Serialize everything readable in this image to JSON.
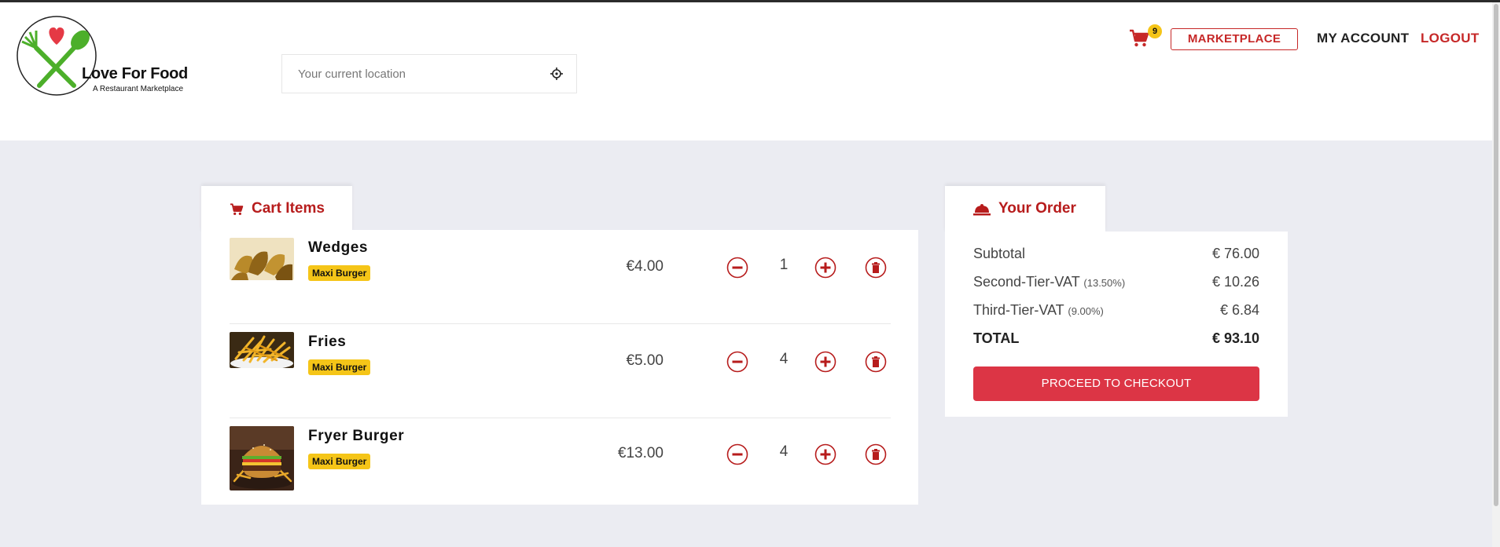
{
  "brand": {
    "name": "Love For Food",
    "tagline": "A Restaurant Marketplace"
  },
  "search": {
    "placeholder": "Your current location"
  },
  "nav": {
    "cart_count": "9",
    "marketplace_label": "MARKETPLACE",
    "account_label": "MY ACCOUNT",
    "logout_label": "LOGOUT"
  },
  "cart": {
    "title": "Cart Items",
    "items": [
      {
        "name": "Wedges",
        "tag": "Maxi Burger",
        "price": "€4.00",
        "qty": "1"
      },
      {
        "name": "Fries",
        "tag": "Maxi Burger",
        "price": "€5.00",
        "qty": "4"
      },
      {
        "name": "Fryer Burger",
        "tag": "Maxi Burger",
        "price": "€13.00",
        "qty": "4"
      }
    ]
  },
  "order": {
    "title": "Your Order",
    "subtotal_label": "Subtotal",
    "subtotal_value": "€ 76.00",
    "vat2_label": "Second-Tier-VAT",
    "vat2_rate": "(13.50%)",
    "vat2_value": "€ 10.26",
    "vat3_label": "Third-Tier-VAT",
    "vat3_rate": "(9.00%)",
    "vat3_value": "€ 6.84",
    "total_label": "TOTAL",
    "total_value": "€ 93.10",
    "checkout_label": "PROCEED TO CHECKOUT"
  },
  "colors": {
    "accent": "#c62828",
    "checkout": "#dc3545",
    "badge": "#f5c518",
    "background": "#ebecf2"
  },
  "icons": [
    "cart-icon",
    "crosshair-icon",
    "minus-circle-icon",
    "plus-circle-icon",
    "trash-icon",
    "cloche-icon"
  ]
}
